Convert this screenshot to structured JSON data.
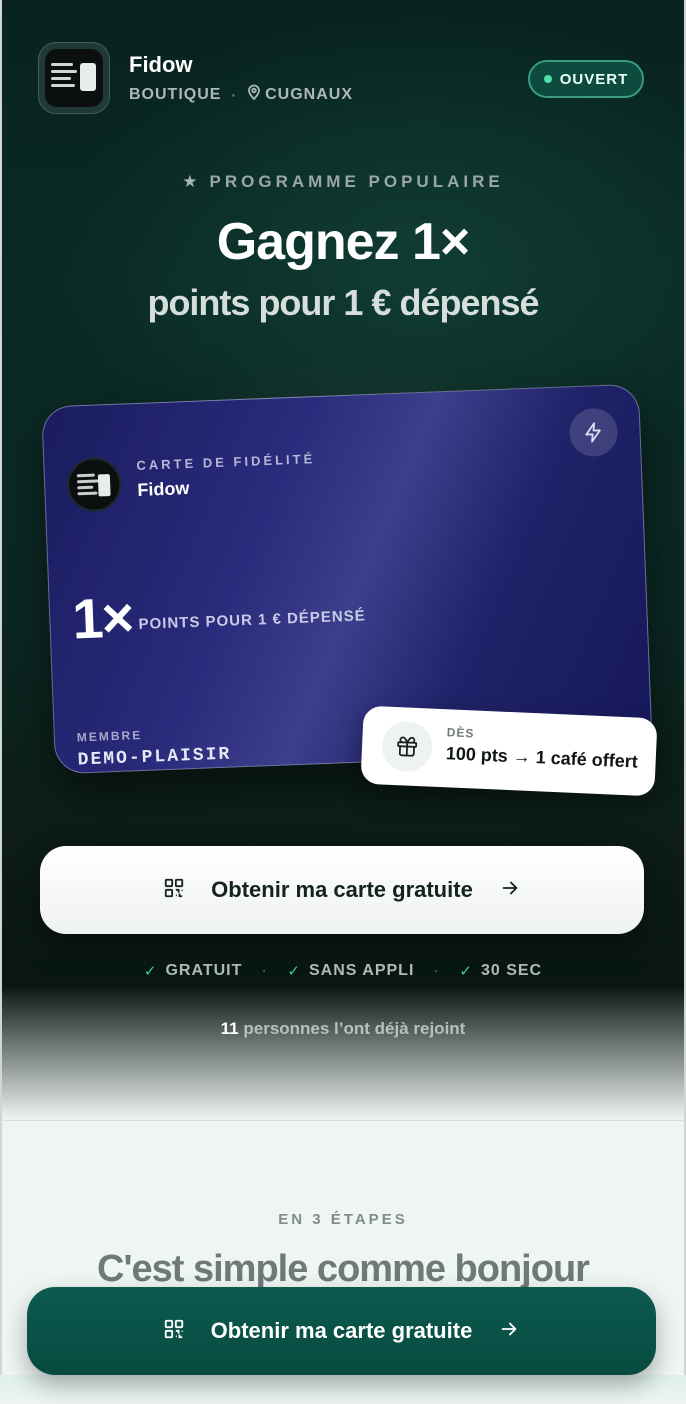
{
  "header": {
    "brand": "Fidow",
    "category": "BOUTIQUE",
    "city": "CUGNAUX",
    "status": "OUVERT",
    "status_color": "#4fe0a8"
  },
  "hero": {
    "eyebrow": "PROGRAMME POPULAIRE",
    "headline": "Gagnez 1×",
    "subhead": "points pour 1 € dépensé"
  },
  "card": {
    "label": "CARTE DE FIDÉLITÉ",
    "brand": "Fidow",
    "multiplier": "1×",
    "multiplier_text": "POINTS POUR 1 € DÉPENSÉ",
    "member_label": "MEMBRE",
    "member": "DEMO-PLAISIR",
    "accent": "#2a2b7c"
  },
  "reward": {
    "label": "DÈS",
    "text": "100 pts → 1 café offert"
  },
  "cta": {
    "label": "Obtenir ma carte gratuite"
  },
  "checks": [
    "GRATUIT",
    "SANS APPLI",
    "30 SEC"
  ],
  "social_proof": {
    "count": "11",
    "text": "personnes l’ont déjà rejoint"
  },
  "steps": {
    "eyebrow": "EN 3 ÉTAPES",
    "title": "C'est simple comme bonjour"
  },
  "sticky_cta": {
    "label": "Obtenir ma carte gratuite",
    "color": "#0c5a4f"
  }
}
